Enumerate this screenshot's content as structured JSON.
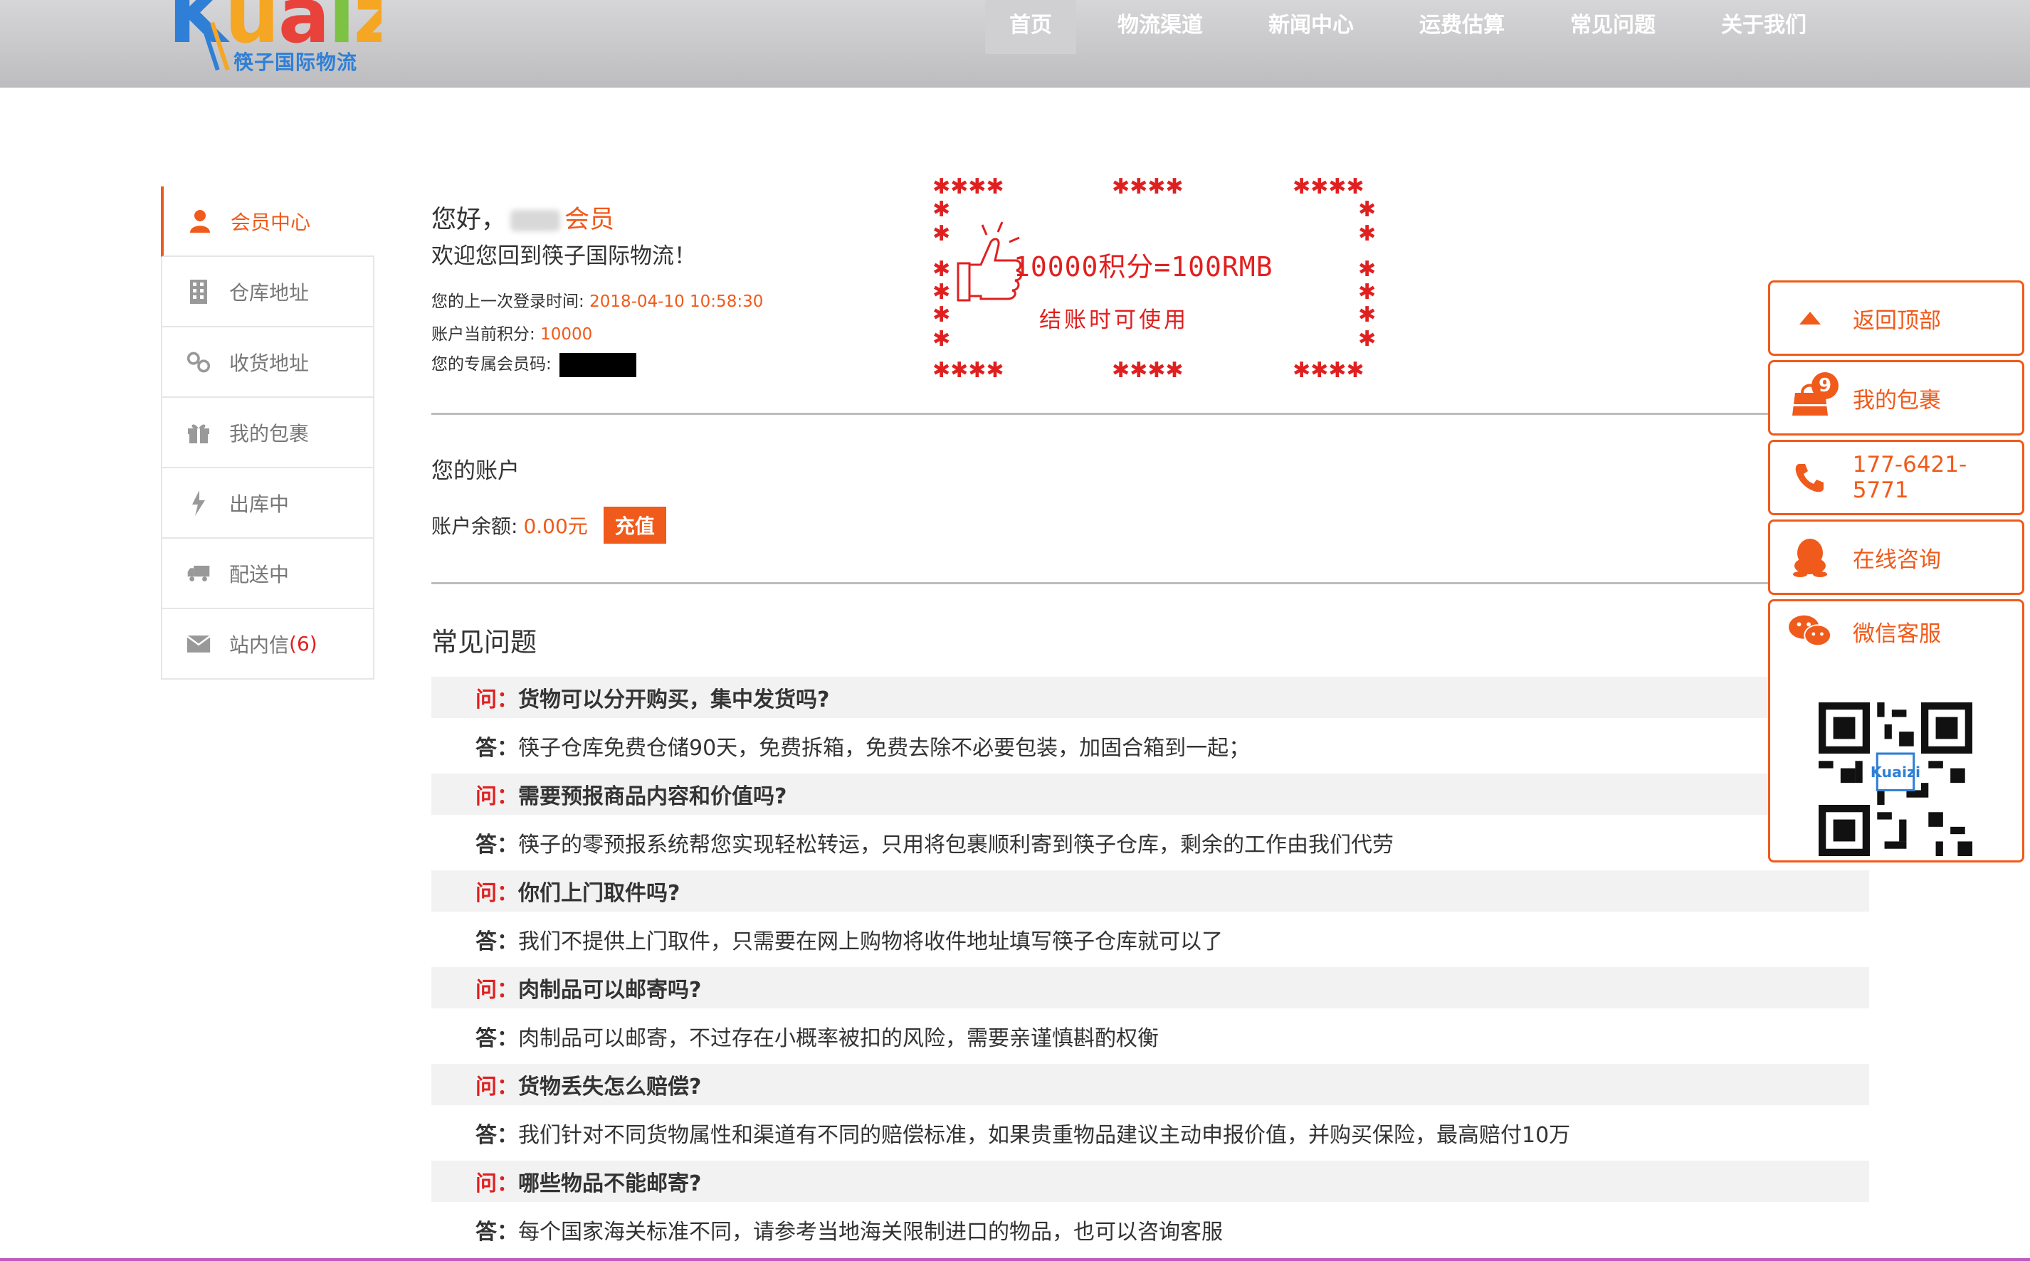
{
  "header": {
    "logo_word": "Kuaizi",
    "logo_cn": "筷子国际物流",
    "nav": [
      "首页",
      "物流渠道",
      "新闻中心",
      "运费估算",
      "常见问题",
      "关于我们"
    ]
  },
  "sidebar": {
    "items": [
      {
        "label": "会员中心",
        "icon": "user-icon"
      },
      {
        "label": "仓库地址",
        "icon": "building-icon"
      },
      {
        "label": "收货地址",
        "icon": "location-icon"
      },
      {
        "label": "我的包裹",
        "icon": "gift-icon"
      },
      {
        "label": "出库中",
        "icon": "lightning-icon"
      },
      {
        "label": "配送中",
        "icon": "truck-icon"
      },
      {
        "label": "站内信",
        "icon": "mail-icon",
        "count": "(6)"
      }
    ]
  },
  "member": {
    "greeting": "您好，",
    "member_label": "会员",
    "welcome": "欢迎您回到筷子国际物流！",
    "last_login_label": "您的上一次登录时间: ",
    "last_login_value": "2018-04-10 10:58:30",
    "points_label": "账户当前积分: ",
    "points_value": "10000",
    "code_label": "您的专属会员码: "
  },
  "promo": {
    "line1": "10000积分=100RMB",
    "line2": "结账时可使用"
  },
  "account": {
    "title": "您的账户",
    "balance_label": "账户余额: ",
    "balance_value": "0.00元",
    "recharge_label": "充值"
  },
  "faq": {
    "title": "常见问题",
    "q_label": "问：",
    "a_label": "答：",
    "items": [
      {
        "q": "货物可以分开购买，集中发货吗?",
        "a": "筷子仓库免费仓储90天，免费拆箱，免费去除不必要包装，加固合箱到一起；"
      },
      {
        "q": "需要预报商品内容和价值吗?",
        "a": "筷子的零预报系统帮您实现轻松转运，只用将包裹顺利寄到筷子仓库，剩余的工作由我们代劳"
      },
      {
        "q": "你们上门取件吗?",
        "a": "我们不提供上门取件，只需要在网上购物将收件地址填写筷子仓库就可以了"
      },
      {
        "q": "肉制品可以邮寄吗?",
        "a": "肉制品可以邮寄，不过存在小概率被扣的风险，需要亲谨慎斟酌权衡"
      },
      {
        "q": "货物丢失怎么赔偿?",
        "a": "我们针对不同货物属性和渠道有不同的赔偿标准，如果贵重物品建议主动申报价值，并购买保险，最高赔付10万"
      },
      {
        "q": "哪些物品不能邮寄?",
        "a": "每个国家海关标准不同，请参考当地海关限制进口的物品，也可以咨询客服"
      }
    ]
  },
  "float": {
    "back_top": "返回顶部",
    "my_package": "我的包裹",
    "package_badge": "9",
    "phone": "177-6421-5771",
    "online": "在线咨询",
    "wechat": "微信客服"
  },
  "colors": {
    "accent": "#f05a1a",
    "red": "#e02020",
    "header_bg": "#c8c8ca"
  }
}
